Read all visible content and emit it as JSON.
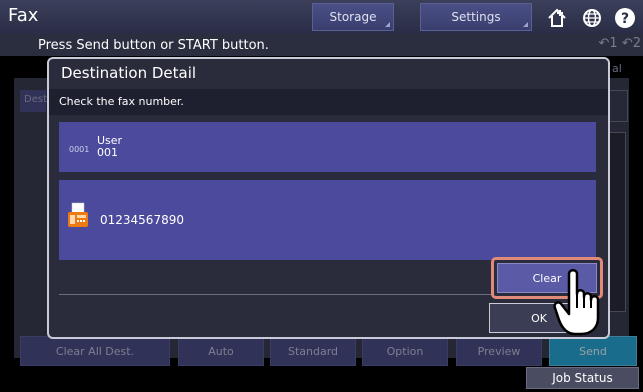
{
  "app": {
    "title": "Fax"
  },
  "tabs": [
    {
      "label": "Storage"
    },
    {
      "label": "Settings"
    }
  ],
  "top_icons": [
    "home-add-icon",
    "globe-icon",
    "help-icon"
  ],
  "message": "Press Send button or START button.",
  "line_indicators": "↶1  ↶2",
  "background": {
    "left_tab": "Dest",
    "right_fragment": "al",
    "bottom_buttons": [
      "Clear All Dest.",
      "Auto",
      "Standard",
      "Option",
      "Preview",
      "Send"
    ],
    "job_status": "Job Status"
  },
  "dialog": {
    "title": "Destination Detail",
    "subtitle": "Check the fax number.",
    "entry": {
      "number": "0001",
      "name_line1": "User",
      "name_line2": "001"
    },
    "fax_number": "01234567890",
    "clear_label": "Clear",
    "ok_label": "OK"
  },
  "colors": {
    "card": "#4b4a9c",
    "highlight": "#e28a7a",
    "send": "#29a7d8"
  }
}
